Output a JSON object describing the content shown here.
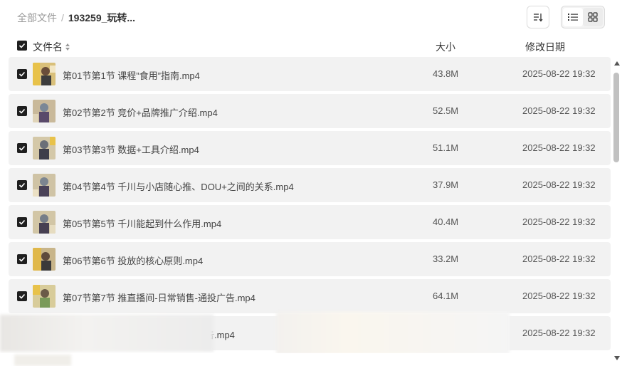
{
  "breadcrumb": {
    "root": "全部文件",
    "separator": "/",
    "current": "193259_玩转..."
  },
  "toolbar": {
    "sort_icon": "sort-lines-icon",
    "list_view_icon": "list-view-icon",
    "grid_view_icon": "grid-view-icon"
  },
  "columns": {
    "name": "文件名",
    "size": "大小",
    "date": "修改日期"
  },
  "files": [
    {
      "name": "第01节第1节 课程”食用”指南.mp4",
      "size": "43.8M",
      "date": "2025-08-22 19:32",
      "checked": true
    },
    {
      "name": "第02节第2节 竞价+品牌推广介绍.mp4",
      "size": "52.5M",
      "date": "2025-08-22 19:32",
      "checked": true
    },
    {
      "name": "第03节第3节 数据+工具介绍.mp4",
      "size": "51.1M",
      "date": "2025-08-22 19:32",
      "checked": true
    },
    {
      "name": "第04节第4节 千川与小店随心推、DOU+之间的关系.mp4",
      "size": "37.9M",
      "date": "2025-08-22 19:32",
      "checked": true
    },
    {
      "name": "第05节第5节 千川能起到什么作用.mp4",
      "size": "40.4M",
      "date": "2025-08-22 19:32",
      "checked": true
    },
    {
      "name": "第06节第6节 投放的核心原则.mp4",
      "size": "33.2M",
      "date": "2025-08-22 19:32",
      "checked": true
    },
    {
      "name": "第07节第7节 推直播间-日常销售-通投广告.mp4",
      "size": "64.1M",
      "date": "2025-08-22 19:32",
      "checked": true
    },
    {
      "name": "告.mp4",
      "size": "",
      "date": "2025-08-22 19:32",
      "checked": false
    }
  ],
  "colors": {
    "row_bg": "#f2f2f2",
    "checkbox": "#1f1f1f",
    "muted_text": "#9a9a9a"
  }
}
